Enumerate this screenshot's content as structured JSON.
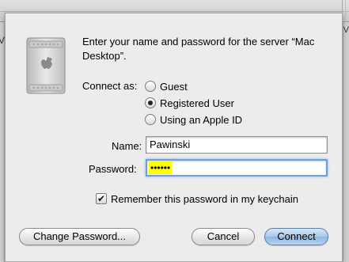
{
  "dialog": {
    "message": "Enter your name and password for the server “Mac Desktop”.",
    "connect_as_label": "Connect as:",
    "options": [
      {
        "label": "Guest",
        "selected": false
      },
      {
        "label": "Registered User",
        "selected": true
      },
      {
        "label": "Using an Apple ID",
        "selected": false
      }
    ],
    "name_label": "Name:",
    "name_value": "Pawinski",
    "password_label": "Password:",
    "password_value": "••••••",
    "remember_label": "Remember this password in my keychain",
    "remember_checked": true,
    "buttons": {
      "change_password": "Change Password...",
      "cancel": "Cancel",
      "connect": "Connect"
    }
  },
  "icons": {
    "server": "mac-pro-icon",
    "checkmark": "✔"
  },
  "chrome": {
    "left_glyph": "V",
    "right_glyph": "V"
  },
  "colors": {
    "password_highlight": "#ffff00",
    "focus_ring": "#6aa0dd",
    "default_button": "#8db6e2"
  }
}
